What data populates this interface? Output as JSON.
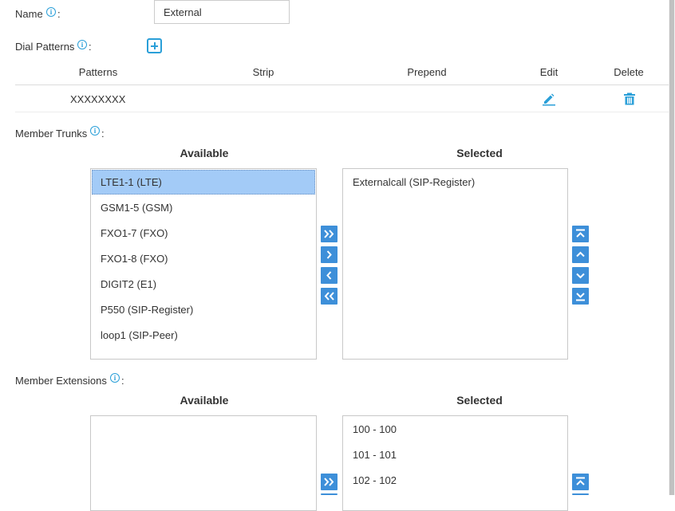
{
  "name_field": {
    "label": "Name",
    "colon": ":",
    "value": "External"
  },
  "dial_patterns": {
    "label": "Dial Patterns",
    "colon": ":",
    "columns": [
      "Patterns",
      "Strip",
      "Prepend",
      "Edit",
      "Delete"
    ],
    "rows": [
      {
        "pattern": "XXXXXXXX",
        "strip": "",
        "prepend": ""
      }
    ]
  },
  "member_trunks": {
    "label": "Member Trunks",
    "colon": ":",
    "available_header": "Available",
    "selected_header": "Selected",
    "available": [
      "LTE1-1 (LTE)",
      "GSM1-5 (GSM)",
      "FXO1-7 (FXO)",
      "FXO1-8 (FXO)",
      "DIGIT2 (E1)",
      "P550 (SIP-Register)",
      "loop1 (SIP-Peer)"
    ],
    "highlighted": "LTE1-1 (LTE)",
    "selected": [
      "Externalcall (SIP-Register)"
    ]
  },
  "member_extensions": {
    "label": "Member Extensions",
    "colon": ":",
    "available_header": "Available",
    "selected_header": "Selected",
    "available": [],
    "selected": [
      "100 - 100",
      "101 - 101",
      "102 - 102"
    ]
  },
  "icons": {
    "info": "info-icon",
    "add": "plus-square-icon",
    "edit": "pencil-icon",
    "delete": "trash-icon",
    "move_all_right": "double-chevron-right-icon",
    "move_right": "chevron-right-icon",
    "move_left": "chevron-left-icon",
    "move_all_left": "double-chevron-left-icon",
    "move_top": "move-to-top-icon",
    "move_up": "chevron-up-icon",
    "move_down": "chevron-down-icon",
    "move_bottom": "move-to-bottom-icon"
  },
  "colors": {
    "accent": "#2a9fd8",
    "button": "#3d8fd9",
    "highlight": "#a3cbf7"
  }
}
